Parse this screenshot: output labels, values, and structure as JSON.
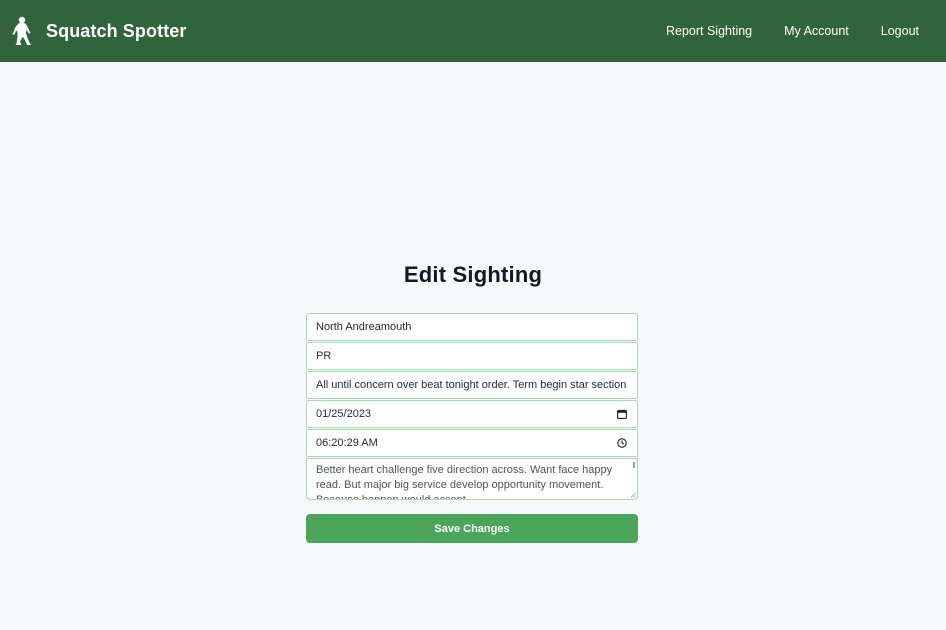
{
  "app": {
    "name": "Squatch Spotter",
    "logo_icon": "bigfoot-icon"
  },
  "nav": {
    "links": [
      "Report Sighting",
      "My Account",
      "Logout"
    ]
  },
  "page": {
    "title": "Edit Sighting"
  },
  "form": {
    "city": "North Andreamouth",
    "state": "PR",
    "summary": "All until concern over beat tonight order. Term begin star section s",
    "date": "01/25/2023",
    "date_icon": "calendar-icon",
    "time": "06:20:29 AM",
    "time_icon": "clock-icon",
    "description": "Better heart challenge five direction across. Want face happy read. But major big service develop opportunity movement. Because happen would accept",
    "submit_label": "Save Changes"
  },
  "colors": {
    "navbar": "#31643b",
    "accent": "#4ba55a",
    "field_border": "#a9dcb1",
    "page_background": "#f7f8fa"
  }
}
